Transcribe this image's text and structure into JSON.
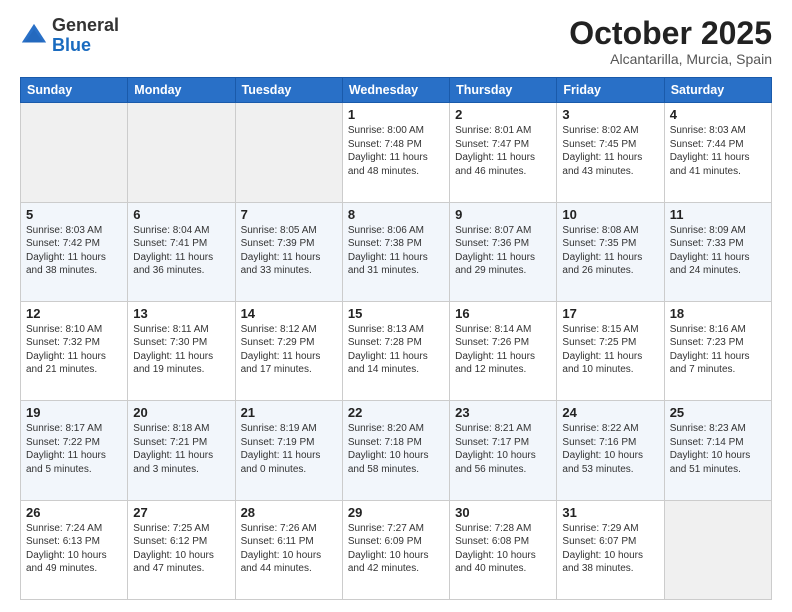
{
  "header": {
    "logo_general": "General",
    "logo_blue": "Blue",
    "month_title": "October 2025",
    "subtitle": "Alcantarilla, Murcia, Spain"
  },
  "weekdays": [
    "Sunday",
    "Monday",
    "Tuesday",
    "Wednesday",
    "Thursday",
    "Friday",
    "Saturday"
  ],
  "weeks": [
    [
      {
        "day": "",
        "info": ""
      },
      {
        "day": "",
        "info": ""
      },
      {
        "day": "",
        "info": ""
      },
      {
        "day": "1",
        "info": "Sunrise: 8:00 AM\nSunset: 7:48 PM\nDaylight: 11 hours\nand 48 minutes."
      },
      {
        "day": "2",
        "info": "Sunrise: 8:01 AM\nSunset: 7:47 PM\nDaylight: 11 hours\nand 46 minutes."
      },
      {
        "day": "3",
        "info": "Sunrise: 8:02 AM\nSunset: 7:45 PM\nDaylight: 11 hours\nand 43 minutes."
      },
      {
        "day": "4",
        "info": "Sunrise: 8:03 AM\nSunset: 7:44 PM\nDaylight: 11 hours\nand 41 minutes."
      }
    ],
    [
      {
        "day": "5",
        "info": "Sunrise: 8:03 AM\nSunset: 7:42 PM\nDaylight: 11 hours\nand 38 minutes."
      },
      {
        "day": "6",
        "info": "Sunrise: 8:04 AM\nSunset: 7:41 PM\nDaylight: 11 hours\nand 36 minutes."
      },
      {
        "day": "7",
        "info": "Sunrise: 8:05 AM\nSunset: 7:39 PM\nDaylight: 11 hours\nand 33 minutes."
      },
      {
        "day": "8",
        "info": "Sunrise: 8:06 AM\nSunset: 7:38 PM\nDaylight: 11 hours\nand 31 minutes."
      },
      {
        "day": "9",
        "info": "Sunrise: 8:07 AM\nSunset: 7:36 PM\nDaylight: 11 hours\nand 29 minutes."
      },
      {
        "day": "10",
        "info": "Sunrise: 8:08 AM\nSunset: 7:35 PM\nDaylight: 11 hours\nand 26 minutes."
      },
      {
        "day": "11",
        "info": "Sunrise: 8:09 AM\nSunset: 7:33 PM\nDaylight: 11 hours\nand 24 minutes."
      }
    ],
    [
      {
        "day": "12",
        "info": "Sunrise: 8:10 AM\nSunset: 7:32 PM\nDaylight: 11 hours\nand 21 minutes."
      },
      {
        "day": "13",
        "info": "Sunrise: 8:11 AM\nSunset: 7:30 PM\nDaylight: 11 hours\nand 19 minutes."
      },
      {
        "day": "14",
        "info": "Sunrise: 8:12 AM\nSunset: 7:29 PM\nDaylight: 11 hours\nand 17 minutes."
      },
      {
        "day": "15",
        "info": "Sunrise: 8:13 AM\nSunset: 7:28 PM\nDaylight: 11 hours\nand 14 minutes."
      },
      {
        "day": "16",
        "info": "Sunrise: 8:14 AM\nSunset: 7:26 PM\nDaylight: 11 hours\nand 12 minutes."
      },
      {
        "day": "17",
        "info": "Sunrise: 8:15 AM\nSunset: 7:25 PM\nDaylight: 11 hours\nand 10 minutes."
      },
      {
        "day": "18",
        "info": "Sunrise: 8:16 AM\nSunset: 7:23 PM\nDaylight: 11 hours\nand 7 minutes."
      }
    ],
    [
      {
        "day": "19",
        "info": "Sunrise: 8:17 AM\nSunset: 7:22 PM\nDaylight: 11 hours\nand 5 minutes."
      },
      {
        "day": "20",
        "info": "Sunrise: 8:18 AM\nSunset: 7:21 PM\nDaylight: 11 hours\nand 3 minutes."
      },
      {
        "day": "21",
        "info": "Sunrise: 8:19 AM\nSunset: 7:19 PM\nDaylight: 11 hours\nand 0 minutes."
      },
      {
        "day": "22",
        "info": "Sunrise: 8:20 AM\nSunset: 7:18 PM\nDaylight: 10 hours\nand 58 minutes."
      },
      {
        "day": "23",
        "info": "Sunrise: 8:21 AM\nSunset: 7:17 PM\nDaylight: 10 hours\nand 56 minutes."
      },
      {
        "day": "24",
        "info": "Sunrise: 8:22 AM\nSunset: 7:16 PM\nDaylight: 10 hours\nand 53 minutes."
      },
      {
        "day": "25",
        "info": "Sunrise: 8:23 AM\nSunset: 7:14 PM\nDaylight: 10 hours\nand 51 minutes."
      }
    ],
    [
      {
        "day": "26",
        "info": "Sunrise: 7:24 AM\nSunset: 6:13 PM\nDaylight: 10 hours\nand 49 minutes."
      },
      {
        "day": "27",
        "info": "Sunrise: 7:25 AM\nSunset: 6:12 PM\nDaylight: 10 hours\nand 47 minutes."
      },
      {
        "day": "28",
        "info": "Sunrise: 7:26 AM\nSunset: 6:11 PM\nDaylight: 10 hours\nand 44 minutes."
      },
      {
        "day": "29",
        "info": "Sunrise: 7:27 AM\nSunset: 6:09 PM\nDaylight: 10 hours\nand 42 minutes."
      },
      {
        "day": "30",
        "info": "Sunrise: 7:28 AM\nSunset: 6:08 PM\nDaylight: 10 hours\nand 40 minutes."
      },
      {
        "day": "31",
        "info": "Sunrise: 7:29 AM\nSunset: 6:07 PM\nDaylight: 10 hours\nand 38 minutes."
      },
      {
        "day": "",
        "info": ""
      }
    ]
  ]
}
